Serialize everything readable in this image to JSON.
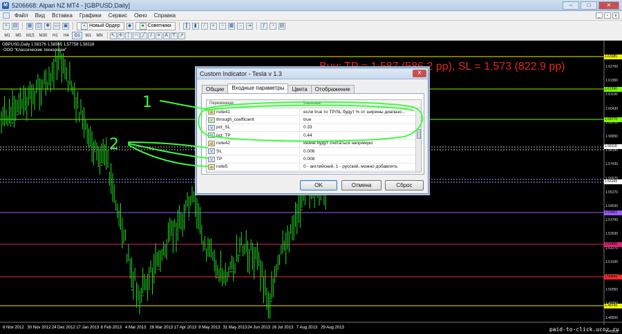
{
  "window": {
    "title": "5206668: Alpari NZ MT4 - [GBPUSD,Daily]",
    "app_icon": "mt4-icon"
  },
  "menu": [
    "Файл",
    "Вид",
    "Вставка",
    "Графики",
    "Сервис",
    "Окно",
    "Справка"
  ],
  "toolbar": {
    "new_order": "Новый Ордер",
    "advisors": "Советники"
  },
  "timeframes": [
    "M1",
    "M5",
    "M15",
    "M30",
    "H1",
    "H4",
    "D1",
    "W1",
    "MN"
  ],
  "active_timeframe": "D1",
  "chart": {
    "symbol_header": "GBPUSD,Daily 1.58176 1.58365 1.57758 1.58118",
    "copyright": "OOO \"Классические технологии\"",
    "signal_text": "Buy: TP = 1.587 (586.2 pp), SL = 1.573 (822.9 pp)",
    "price_labels": [
      "1.62700",
      "1.61950",
      "1.61190",
      "1.60430",
      "1.59710",
      "1.58950",
      "1.58190",
      "1.57430",
      "1.56670",
      "1.55270",
      "1.54530",
      "1.53790",
      "1.53030",
      "1.52270",
      "1.51530",
      "1.50790",
      "1.50050",
      "1.49290",
      "1.48550",
      "1.47810"
    ],
    "price_tags": [
      {
        "text": "1.63385",
        "color": "#f2f200"
      },
      {
        "text": "1.61590",
        "color": "#7cfc00"
      },
      {
        "text": "1.59779",
        "color": "#7cfc00"
      },
      {
        "text": "1.58118",
        "color": "#ffffff"
      },
      {
        "text": "1.56169",
        "color": "#ffffff"
      },
      {
        "text": "1.53963",
        "color": "#9c5cff"
      },
      {
        "text": "1.52450",
        "color": "#e0207a"
      },
      {
        "text": "1.50899",
        "color": "#ff2a2a"
      },
      {
        "text": "1.48749",
        "color": "#f2f200"
      }
    ],
    "dates": [
      "8 Nov 2012",
      "30 Nov 2012",
      "24 Dec 2012",
      "17 Jan 2013",
      "8 Feb 2013",
      "4 Mar 2013",
      "26 Mar 2013",
      "17 Apr 2013",
      "9 May 2013",
      "31 May 2013",
      "24 Jun 2013",
      "16 Jul 2013",
      "7 Aug 2013",
      "29 Aug 2013"
    ],
    "watermark": "paid-to-click.ucoz.ru",
    "colors": {
      "candle": "#22e022",
      "background": "#000000",
      "signal": "#e0281f"
    }
  },
  "dialog": {
    "title": "Custom Indicator - Tesla v 1.3",
    "tabs": [
      "Общие",
      "Входные параметры",
      "Цвета",
      "Отображение"
    ],
    "active_tab": "Входные параметры",
    "columns": [
      "Переменная",
      "Значение"
    ],
    "rows": [
      {
        "icon": "ab",
        "name": "note41",
        "value": "если true то TP/SL будут % от ширины диапазо..."
      },
      {
        "icon": "bool",
        "name": "through_coefficient",
        "value": "true"
      },
      {
        "icon": "v",
        "name": "pct_SL",
        "value": "0.33"
      },
      {
        "icon": "v",
        "name": "pct_TP",
        "value": "0.44"
      },
      {
        "icon": "ab",
        "name": "note42",
        "value": "иначе будут считаться напрямую:"
      },
      {
        "icon": "v",
        "name": "SL",
        "value": "0.006"
      },
      {
        "icon": "v",
        "name": "TP",
        "value": "0.008"
      },
      {
        "icon": "ab",
        "name": "note5",
        "value": "0 - английский, 1 - русский, можно добавлять"
      }
    ],
    "buttons": {
      "ok": "OK",
      "cancel": "Отмена",
      "reset": "Сброс"
    }
  },
  "annotations": {
    "label1": "1",
    "label2": "2",
    "color": "#3cff3c"
  }
}
